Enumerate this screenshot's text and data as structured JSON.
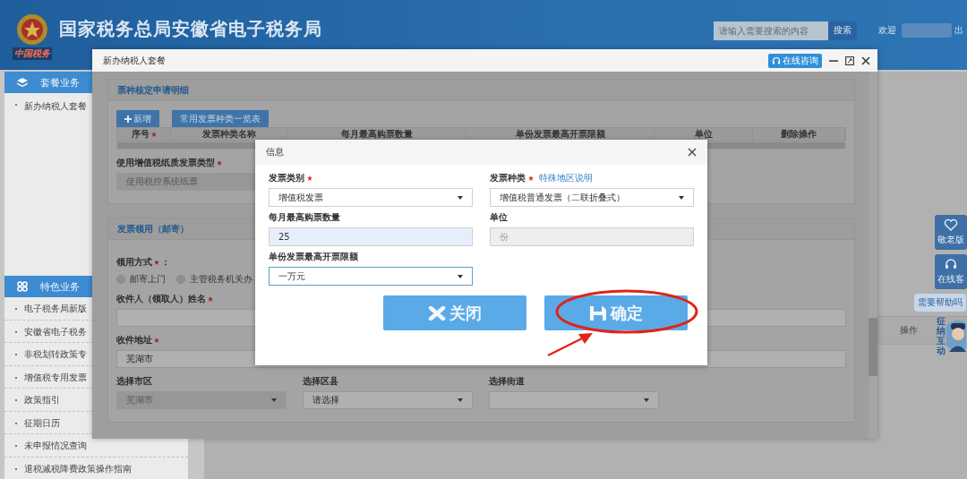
{
  "header": {
    "logo_text": "中国税务",
    "title": "国家税务总局安徽省电子税务局",
    "search": {
      "placeholder": "请输入需要搜索的内容"
    },
    "search_button": "搜索",
    "welcome": "欢迎",
    "logout": "出"
  },
  "sidebar": [
    {
      "title": "套餐业务",
      "items": [
        "新办纳税人套餐"
      ]
    },
    {
      "title": "特色业务",
      "items": [
        "电子税务局新版",
        "安徽省电子税务",
        "非税划转政策专",
        "增值税专用发票",
        "政策指引",
        "征期日历",
        "未申报情况查询",
        "退税减税降费政策操作指南"
      ]
    }
  ],
  "main_table": {
    "column": "操作"
  },
  "floating": {
    "elder_button": "敬老版",
    "service_button": "在线客",
    "help_bubble": "需要帮助吗",
    "mascot_text": "征纳互动"
  },
  "modal": {
    "title": "新办纳税人套餐",
    "consult_button": "在线咨询",
    "apply_panel": {
      "title": "票种核定申请明细",
      "add_button": "新增",
      "list_button": "常用发票种类一览表",
      "columns": [
        {
          "label": "序号",
          "required": true
        },
        {
          "label": "发票种类名称",
          "required": false
        },
        {
          "label": "每月最高购票数量",
          "required": false
        },
        {
          "label": "单份发票最高开票限额",
          "required": false
        },
        {
          "label": "单位",
          "required": false
        },
        {
          "label": "删除操作",
          "required": false
        }
      ],
      "paper_type": {
        "label": "使用增值税纸质发票类型",
        "required": true,
        "value": "使用税控系统纸票"
      }
    },
    "receive_panel": {
      "title": "发票领用（邮寄）",
      "method": {
        "label": "领用方式",
        "required": true,
        "suffix": "：",
        "options": [
          {
            "label": "邮寄上门",
            "selected": false
          },
          {
            "label": "主管税务机关办",
            "selected": false
          }
        ]
      },
      "recipient": {
        "label": "收件人（领取人）姓名",
        "required": true
      },
      "address": {
        "label": "收件地址",
        "required": true,
        "value": "芜湖市"
      },
      "selects": [
        {
          "label": "选择市区",
          "value": "芜湖市",
          "disabled": true
        },
        {
          "label": "选择区县",
          "value": "请选择",
          "disabled": false
        },
        {
          "label": "选择街道",
          "disabled": false
        }
      ]
    }
  },
  "dialog": {
    "title": "信息",
    "fields": [
      {
        "label": "发票类别",
        "required": true,
        "kind": "select",
        "value": "增值税发票"
      },
      {
        "label": "发票种类",
        "required": true,
        "link": "特殊地区说明",
        "kind": "select",
        "value": "增值税普通发票（二联折叠式）"
      },
      {
        "label": "每月最高购票数量",
        "required": false,
        "kind": "input",
        "value": "25",
        "highlighted": true
      },
      {
        "label": "单位",
        "required": false,
        "kind": "input",
        "value": "份",
        "disabled": true
      },
      {
        "label": "单份发票最高开票限额",
        "required": false,
        "kind": "select",
        "value": "一万元",
        "focused": true
      }
    ],
    "buttons": [
      {
        "label": "关闭",
        "kind": "close",
        "circled": false
      },
      {
        "label": "确定",
        "kind": "confirm",
        "circled": true
      }
    ]
  }
}
